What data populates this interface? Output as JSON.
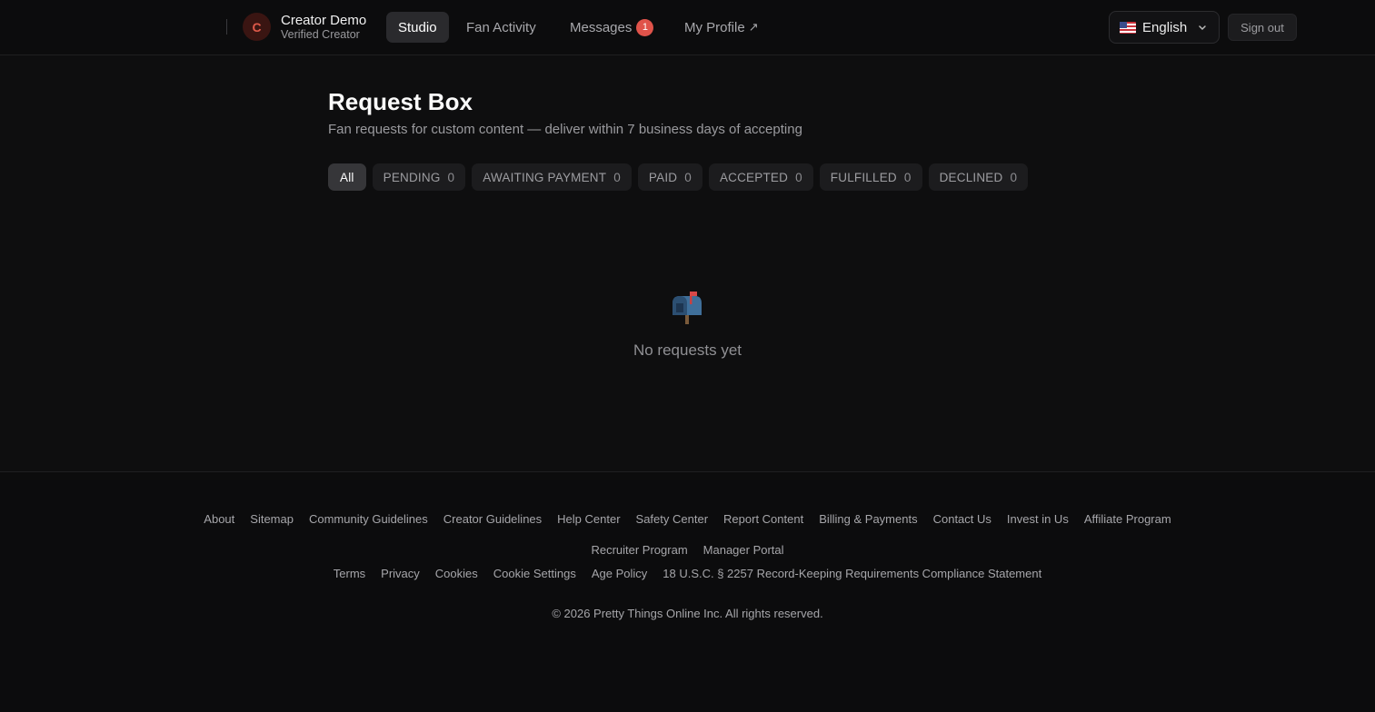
{
  "header": {
    "avatar_initial": "C",
    "creator_name": "Creator Demo",
    "creator_status": "Verified Creator",
    "nav": [
      {
        "label": "Studio",
        "active": true
      },
      {
        "label": "Fan Activity",
        "active": false
      },
      {
        "label": "Messages",
        "badge": "1",
        "active": false
      },
      {
        "label": "My Profile",
        "external_glyph": "↗",
        "active": false
      }
    ],
    "language": {
      "flag_icon": "us-flag-icon",
      "label": "English"
    },
    "sign_out_label": "Sign out"
  },
  "main": {
    "title": "Request Box",
    "subtitle": "Fan requests for custom content — deliver within 7 business days of accepting",
    "filters": [
      {
        "label": "All",
        "active": true
      },
      {
        "label": "PENDING",
        "count": "0"
      },
      {
        "label": "AWAITING PAYMENT",
        "count": "0"
      },
      {
        "label": "PAID",
        "count": "0"
      },
      {
        "label": "ACCEPTED",
        "count": "0"
      },
      {
        "label": "FULFILLED",
        "count": "0"
      },
      {
        "label": "DECLINED",
        "count": "0"
      }
    ],
    "empty_state": {
      "icon": "mailbox-icon",
      "text": "No requests yet"
    }
  },
  "footer": {
    "links_row1": [
      "About",
      "Sitemap",
      "Community Guidelines",
      "Creator Guidelines",
      "Help Center",
      "Safety Center",
      "Report Content",
      "Billing & Payments",
      "Contact Us",
      "Invest in Us",
      "Affiliate Program"
    ],
    "links_row2": [
      "Recruiter Program",
      "Manager Portal"
    ],
    "links_row3": [
      "Terms",
      "Privacy",
      "Cookies",
      "Cookie Settings",
      "Age Policy",
      "18 U.S.C. § 2257 Record-Keeping Requirements Compliance Statement"
    ],
    "copyright": "© 2026 Pretty Things Online Inc. All rights reserved."
  },
  "colors": {
    "background": "#0e0e0f",
    "badge": "#e0534a",
    "avatar_text": "#e05a4a"
  }
}
